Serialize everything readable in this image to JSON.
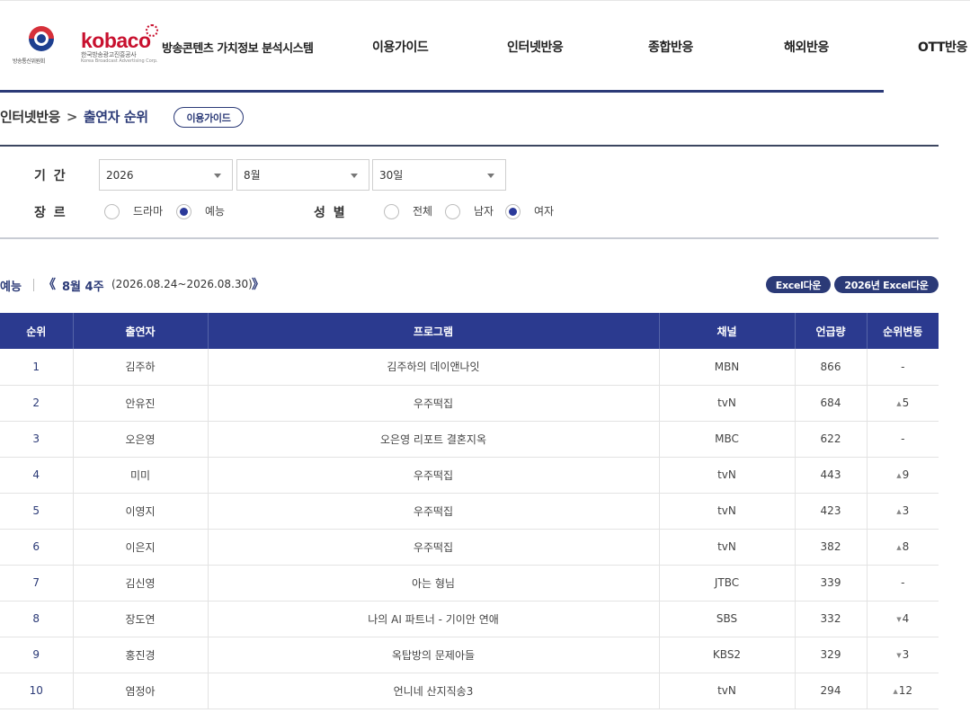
{
  "header": {
    "gov_logo_text": "방송통신위원회",
    "kobaco_logo": "kobaco",
    "kobaco_sub": "한국방송광고진흥공사",
    "kobaco_sub_en": "Korea Broadcast Advertising Corp.",
    "system_title": "방송콘텐츠 가치정보 분석시스템",
    "nav": [
      "이용가이드",
      "인터넷반응",
      "종합반응",
      "해외반응",
      "OTT반응"
    ]
  },
  "breadcrumb": {
    "parent": "인터넷반응",
    "separator": ">",
    "current": "출연자 순위",
    "guide_button": "이용가이드"
  },
  "filter": {
    "period_label": "기 간",
    "year": "2026",
    "month": "8월",
    "day": "30일",
    "genre_label": "장 르",
    "genre_options": [
      "드라마",
      "예능"
    ],
    "genre_selected": "예능",
    "gender_label": "성 별",
    "gender_options": [
      "전체",
      "남자",
      "여자"
    ],
    "gender_selected": "여자"
  },
  "week": {
    "genre": "예능",
    "title": "8월 4주",
    "range": "(2026.08.24~2026.08.30)",
    "prev_icon": "《",
    "next_icon": "》",
    "excel_button": "Excel다운",
    "excel_year_button": "2026년 Excel다운"
  },
  "table": {
    "columns": [
      "순위",
      "출연자",
      "프로그램",
      "채널",
      "언급량",
      "순위변동"
    ],
    "rows": [
      {
        "rank": "1",
        "name": "김주하",
        "program": "김주하의 데이앤나잇",
        "channel": "MBN",
        "mentions": "866",
        "dir": "none",
        "change": "-"
      },
      {
        "rank": "2",
        "name": "안유진",
        "program": "우주떡집",
        "channel": "tvN",
        "mentions": "684",
        "dir": "up",
        "change": "5"
      },
      {
        "rank": "3",
        "name": "오은영",
        "program": "오은영 리포트 결혼지옥",
        "channel": "MBC",
        "mentions": "622",
        "dir": "none",
        "change": "-"
      },
      {
        "rank": "4",
        "name": "미미",
        "program": "우주떡집",
        "channel": "tvN",
        "mentions": "443",
        "dir": "up",
        "change": "9"
      },
      {
        "rank": "5",
        "name": "이영지",
        "program": "우주떡집",
        "channel": "tvN",
        "mentions": "423",
        "dir": "up",
        "change": "3"
      },
      {
        "rank": "6",
        "name": "이은지",
        "program": "우주떡집",
        "channel": "tvN",
        "mentions": "382",
        "dir": "up",
        "change": "8"
      },
      {
        "rank": "7",
        "name": "김신영",
        "program": "아는 형님",
        "channel": "JTBC",
        "mentions": "339",
        "dir": "none",
        "change": "-"
      },
      {
        "rank": "8",
        "name": "장도연",
        "program": "나의 AI 파트너 - 기이안 연애",
        "channel": "SBS",
        "mentions": "332",
        "dir": "down",
        "change": "4"
      },
      {
        "rank": "9",
        "name": "홍진경",
        "program": "옥탑방의 문제아들",
        "channel": "KBS2",
        "mentions": "329",
        "dir": "down",
        "change": "3"
      },
      {
        "rank": "10",
        "name": "염정아",
        "program": "언니네 산지직송3",
        "channel": "tvN",
        "mentions": "294",
        "dir": "up",
        "change": "12"
      }
    ]
  },
  "colors": {
    "accent": "#2b3a77",
    "table_header": "#2b3a8f",
    "brand_red": "#c8102e"
  }
}
